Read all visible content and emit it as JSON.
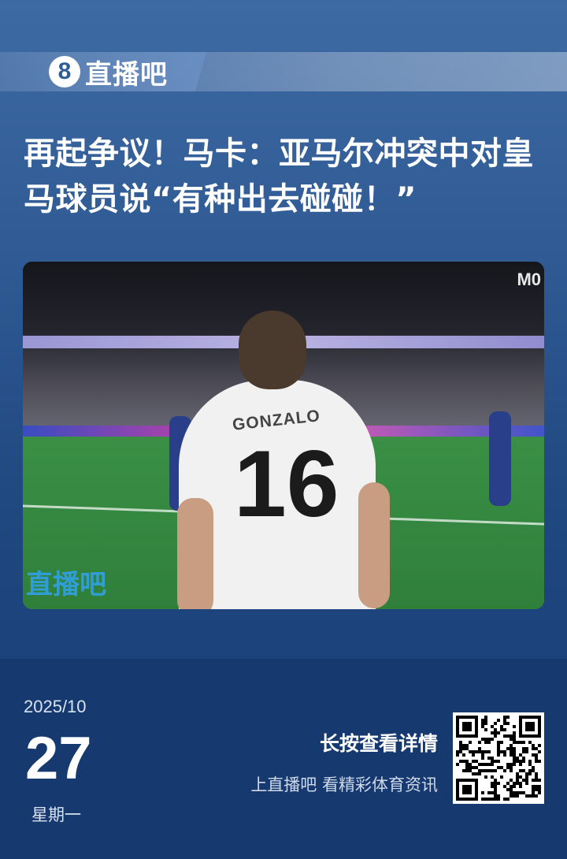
{
  "brand": {
    "logo_mark": "8",
    "name": "直播吧"
  },
  "article": {
    "title": "再起争议！马卡：亚马尔冲突中对皇马球员说“有种出去碰碰！”"
  },
  "photo": {
    "shirt_name": "GONZALO",
    "shirt_number": "16",
    "watermark": "直播吧",
    "broadcaster_mark": "M0"
  },
  "footer": {
    "date_year_month": "2025/10",
    "date_day": "27",
    "weekday": "星期一",
    "cta_main": "长按查看详情",
    "cta_sub": "上直播吧 看精彩体育资讯"
  },
  "colors": {
    "bg_top": "#3e6aa4",
    "bg_bottom": "#163a70",
    "watermark": "#31a3f0"
  }
}
